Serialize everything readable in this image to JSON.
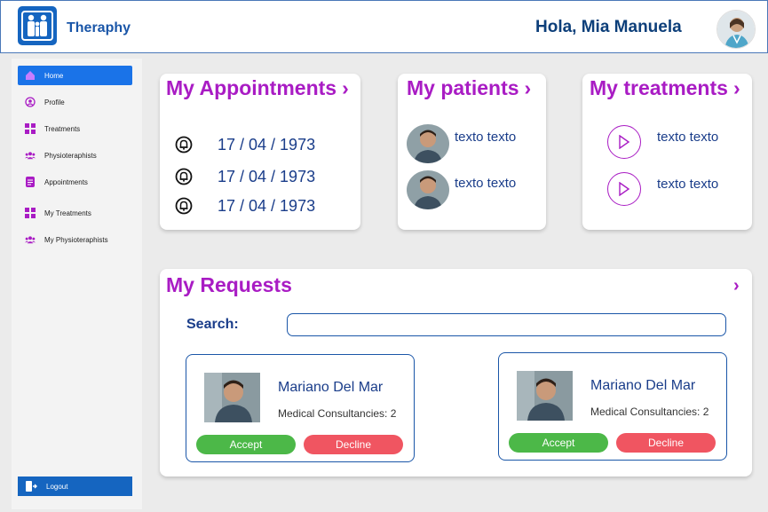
{
  "header": {
    "app_title": "Theraphy",
    "greeting": "Hola, Mia Manuela",
    "logo_icon": "family-logo-icon",
    "avatar_icon": "user-avatar"
  },
  "sidebar": {
    "items": [
      {
        "label": "Home",
        "icon": "home-icon",
        "active": true
      },
      {
        "label": "Profile",
        "icon": "profile-icon"
      },
      {
        "label": "Treatments",
        "icon": "grid-icon"
      },
      {
        "label": "Physioteraphists",
        "icon": "group-icon"
      },
      {
        "label": "Appointments",
        "icon": "document-icon"
      },
      {
        "label": "My Treatments",
        "icon": "grid-icon"
      },
      {
        "label": "My Physioteraphists",
        "icon": "group-icon"
      }
    ],
    "logout_label": "Logout"
  },
  "appointments": {
    "title": "My Appointments",
    "chevron": "›",
    "rows": [
      "17 / 04 / 1973",
      "17 / 04 / 1973",
      "17 / 04 / 1973"
    ]
  },
  "patients": {
    "title": "My patients",
    "chevron": "›",
    "rows": [
      "texto texto",
      "texto texto"
    ]
  },
  "treatments": {
    "title": "My treatments",
    "chevron": "›",
    "rows": [
      "texto texto",
      "texto texto"
    ]
  },
  "requests": {
    "title": "My Requests",
    "chevron": "›",
    "search_label": "Search:",
    "search_placeholder": "",
    "cards": [
      {
        "name": "Mariano Del Mar",
        "meta": "Medical Consultancies: 2",
        "accept": "Accept",
        "decline": "Decline"
      },
      {
        "name": "Mariano Del Mar",
        "meta": "Medical Consultancies: 2",
        "accept": "Accept",
        "decline": "Decline"
      }
    ]
  },
  "colors": {
    "accent_purple": "#a91cc4",
    "primary_blue": "#1565c0",
    "accept_green": "#4cb848",
    "decline_red": "#f05561"
  }
}
